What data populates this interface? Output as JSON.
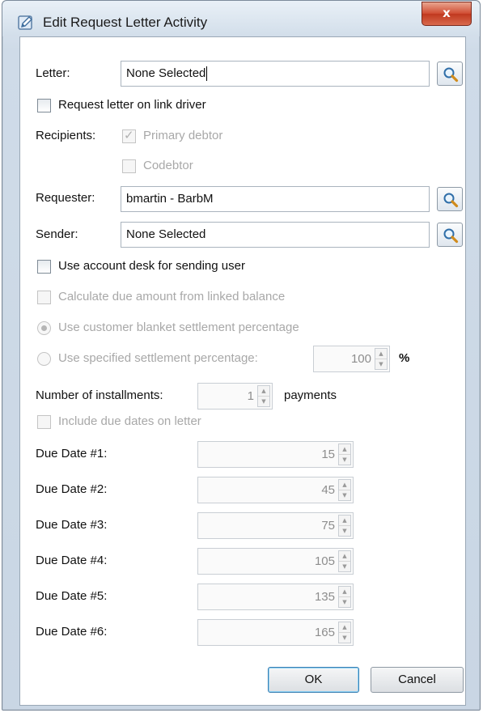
{
  "window": {
    "title": "Edit Request Letter Activity",
    "close_symbol": "x"
  },
  "letter": {
    "label": "Letter:",
    "value": "None Selected",
    "search_icon": "magnifier-icon"
  },
  "request_on_link_driver": {
    "label": "Request letter on link driver",
    "checked": false
  },
  "recipients": {
    "label": "Recipients:",
    "options": [
      {
        "label": "Primary debtor",
        "checked": true,
        "enabled": false
      },
      {
        "label": "Codebtor",
        "checked": false,
        "enabled": false
      }
    ]
  },
  "requester": {
    "label": "Requester:",
    "value": "bmartin - BarbM"
  },
  "sender": {
    "label": "Sender:",
    "value": "None Selected"
  },
  "use_account_desk": {
    "label": "Use account desk for sending user",
    "checked": false
  },
  "calc_due_amount": {
    "label": "Calculate due amount from linked balance",
    "checked": false,
    "enabled": false
  },
  "settlement": {
    "blanket_label": "Use customer blanket settlement percentage",
    "specified_label": "Use specified settlement percentage:",
    "selected": "blanket",
    "percentage_value": "100",
    "percent_symbol": "%"
  },
  "installments": {
    "label": "Number of installments:",
    "value": "1",
    "unit": "payments"
  },
  "include_due_dates": {
    "label": "Include due dates on letter",
    "checked": false,
    "enabled": false
  },
  "due_dates": [
    {
      "label": "Due Date #1:",
      "value": "15"
    },
    {
      "label": "Due Date #2:",
      "value": "45"
    },
    {
      "label": "Due Date #3:",
      "value": "75"
    },
    {
      "label": "Due Date #4:",
      "value": "105"
    },
    {
      "label": "Due Date #5:",
      "value": "135"
    },
    {
      "label": "Due Date #6:",
      "value": "165"
    }
  ],
  "buttons": {
    "ok": "OK",
    "cancel": "Cancel"
  },
  "colors": {
    "titlebar": "#d2deea",
    "close_button": "#c0381f",
    "disabled_text": "#a8a8a8",
    "default_button_border": "#3c7fb1"
  }
}
